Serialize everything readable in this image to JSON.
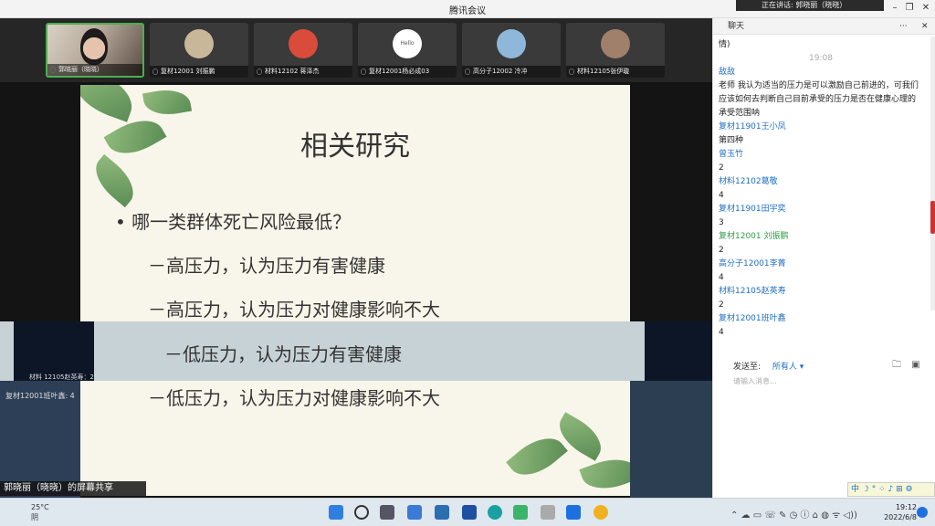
{
  "window": {
    "title": "腾讯会议",
    "speaking": "正在讲话: 郭晓丽（晓晓）"
  },
  "participants": [
    {
      "name": "郭晓丽（晓晓）",
      "type": "camera",
      "active": true
    },
    {
      "name": "复材12001 刘振鹏",
      "type": "avatar",
      "color": "#c9b79a"
    },
    {
      "name": "材料12102 蒋泽杰",
      "type": "avatar",
      "color": "#d94b3a"
    },
    {
      "name": "复材12001杨必成03",
      "type": "avatar",
      "color": "#ffffff",
      "avatar_text": "Hello"
    },
    {
      "name": "高分子12002 冷冲",
      "type": "avatar",
      "color": "#8fb7d9"
    },
    {
      "name": "材料12105张伊璇",
      "type": "avatar",
      "color": "#a0806a"
    }
  ],
  "slide": {
    "title": "相关研究",
    "question": "• 哪一类群体死亡风险最低？",
    "options": [
      "－高压力，认为压力有害健康",
      "－高压力，认为压力对健康影响不大",
      "－低压力，认为压力有害健康",
      "－低压力，认为压力对健康影响不大"
    ]
  },
  "overlays": {
    "left1": "材料 12105赵英寿：2",
    "left2": "复材12001班叶鑫: 4"
  },
  "share_label": "郭晓丽（晓晓）的屏幕共享",
  "chat": {
    "title": "聊天",
    "messages": [
      {
        "kind": "text",
        "text": "情)"
      },
      {
        "kind": "time",
        "text": "19:08"
      },
      {
        "kind": "name",
        "text": "敌敌"
      },
      {
        "kind": "text",
        "text": "老师  我认为适当的压力是可以激励自己前进的，可我们应该如何去判断自己目前承受的压力是否在健康心理的承受范围呐"
      },
      {
        "kind": "name",
        "text": "复材11901王小凤"
      },
      {
        "kind": "text",
        "text": "第四种"
      },
      {
        "kind": "name",
        "text": "曾玉竹"
      },
      {
        "kind": "text",
        "text": "2"
      },
      {
        "kind": "name",
        "text": "材料12102葛敬"
      },
      {
        "kind": "text",
        "text": "4"
      },
      {
        "kind": "name",
        "text": "复材11901田宇奕"
      },
      {
        "kind": "text",
        "text": "3"
      },
      {
        "kind": "name-green",
        "text": "复材12001 刘振鹏"
      },
      {
        "kind": "text",
        "text": "2"
      },
      {
        "kind": "name",
        "text": "高分子12001李菁"
      },
      {
        "kind": "text",
        "text": "4"
      },
      {
        "kind": "name",
        "text": "材料12105赵英寿"
      },
      {
        "kind": "text",
        "text": "2"
      },
      {
        "kind": "name",
        "text": "复材12001班叶鑫"
      },
      {
        "kind": "text",
        "text": "4"
      }
    ],
    "send_to_label": "发送至:",
    "send_to_value": "所有人 ▾",
    "input_placeholder": "请输入消息..."
  },
  "taskbar": {
    "weather_temp": "25°C",
    "weather_desc": "阴",
    "time": "19:12",
    "date": "2022/6/8",
    "ime_label": "中 ☽ ° ⁘ ♪ ⊞ ⚙"
  },
  "colors": {
    "accent": "#1f6fc5",
    "active_border": "#4caf50"
  }
}
